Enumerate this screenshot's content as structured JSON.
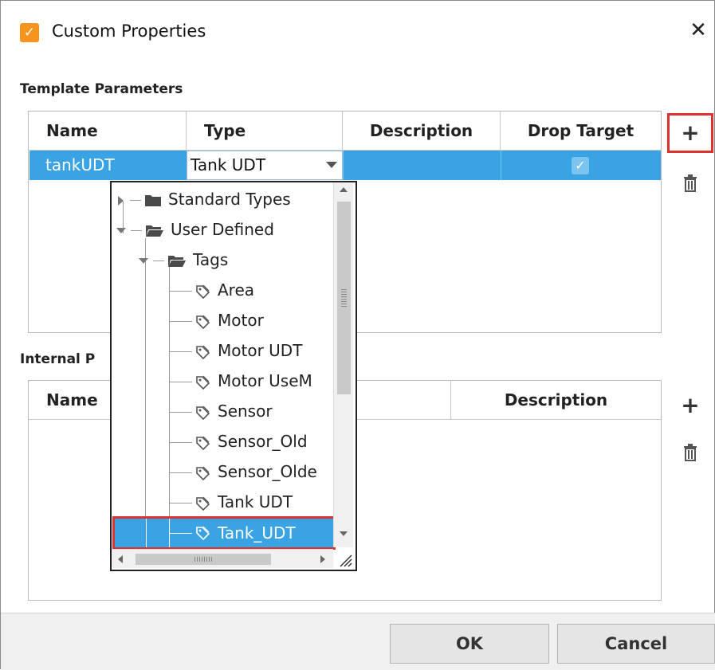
{
  "window": {
    "title": "Custom Properties",
    "close_glyph": "✕",
    "icon": "app-logo-icon"
  },
  "template_parameters": {
    "section_title": "Template Parameters",
    "columns": [
      "Name",
      "Type",
      "Description",
      "Drop Target"
    ],
    "rows": [
      {
        "name": "tankUDT",
        "type": "Tank UDT",
        "description": "",
        "drop_target": true
      }
    ],
    "add_icon": "plus-icon",
    "delete_icon": "trash-icon"
  },
  "internal_properties": {
    "section_title_visible": "Internal P",
    "columns": [
      "Name",
      "Description"
    ],
    "add_icon": "plus-icon",
    "delete_icon": "trash-icon"
  },
  "type_tree": {
    "items": [
      {
        "label": "Standard Types",
        "icon": "folder-icon",
        "expanded": false
      },
      {
        "label": "User Defined",
        "icon": "folder-open-icon",
        "expanded": true
      },
      {
        "label": "Tags",
        "icon": "folder-open-icon",
        "expanded": true
      },
      {
        "label": "Area",
        "icon": "tag-icon"
      },
      {
        "label": "Motor",
        "icon": "tag-icon"
      },
      {
        "label": "Motor UDT",
        "icon": "tag-icon"
      },
      {
        "label": "Motor UseM",
        "icon": "tag-icon"
      },
      {
        "label": "Sensor",
        "icon": "tag-icon"
      },
      {
        "label": "Sensor_Old",
        "icon": "tag-icon"
      },
      {
        "label": "Sensor_Olde",
        "icon": "tag-icon"
      },
      {
        "label": "Tank UDT",
        "icon": "tag-icon"
      },
      {
        "label": "Tank_UDT",
        "icon": "tag-icon",
        "selected": true
      }
    ]
  },
  "footer": {
    "ok_label": "OK",
    "cancel_label": "Cancel"
  },
  "colors": {
    "selection": "#3aa3e3",
    "highlight_box": "#e03131",
    "app_icon": "#f7941d"
  }
}
